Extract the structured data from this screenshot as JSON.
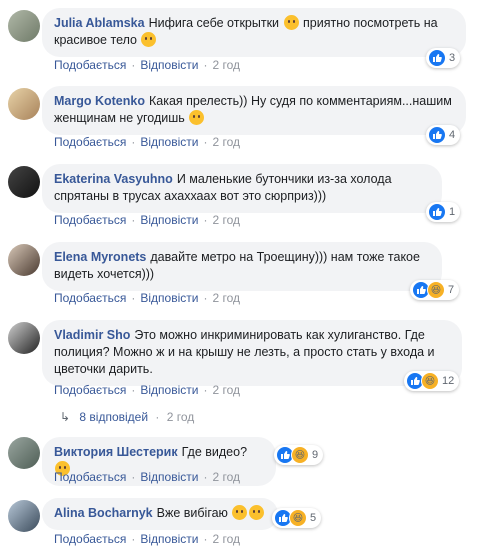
{
  "labels": {
    "like": "Подобається",
    "reply": "Відповісти"
  },
  "comments": [
    {
      "author": "Julia Ablamska",
      "text_a": "Нифига себе открытки",
      "text_b": "приятно посмотреть на красивое тело",
      "time": "2 год",
      "reactions": "3"
    },
    {
      "author": "Margo Kotenko",
      "text_a": "Какая прелесть)) Ну судя по комментариям...нашим женщинам не угодишь",
      "time": "2 год",
      "reactions": "4"
    },
    {
      "author": "Ekaterina Vasyuhno",
      "text_a": "И маленькие бутончики из-за холода спрятаны в трусах ахаххаах вот это сюрприз)))",
      "time": "2 год",
      "reactions": "1"
    },
    {
      "author": "Elena Myronets",
      "text_a": "давайте метро на Троещину))) нам тоже такое видеть хочется)))",
      "time": "2 год",
      "reactions": "7"
    },
    {
      "author": "Vladimir Sho",
      "text_a": "Это можно инкриминировать как хулиганство. Где полиция? Можно ж и на крышу не лезть, а просто стать у входа и цветочки дарить.",
      "time": "2 год",
      "reactions": "12"
    },
    {
      "author": "Виктория Шестерик",
      "text_a": "Где видео?",
      "time": "2 год",
      "reactions": "9"
    },
    {
      "author": "Alina Bocharnyk",
      "text_a": "Вже вибігаю",
      "time": "2 год",
      "reactions": "5"
    }
  ],
  "replies": {
    "label": "8 відповідей",
    "time": "2 год"
  },
  "colors": {
    "link": "#385898",
    "bubble": "#f2f3f5",
    "like": "#1877f2",
    "haha": "#f7b125"
  }
}
